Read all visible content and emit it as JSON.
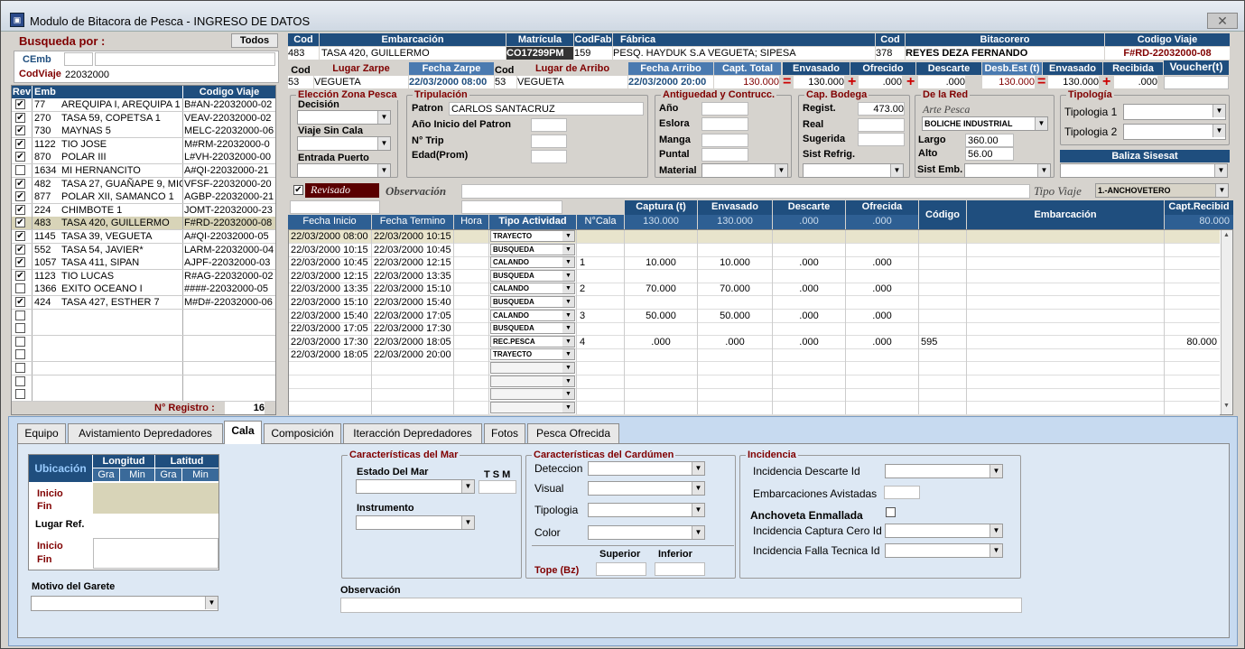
{
  "window": {
    "title": "Modulo de Bitacora de Pesca - INGRESO DE DATOS",
    "close": "✕"
  },
  "search": {
    "label": "Busqueda por :",
    "todos": "Todos",
    "cemb_label": "CEmb",
    "codviaje_label": "CodViaje",
    "cemb_value": "",
    "codviaje_value": "22032000"
  },
  "list": {
    "h_rev": "Rev",
    "h_emb": "Emb",
    "h_cod": "Codigo Viaje",
    "registro_label": "N° Registro :",
    "registro_value": "16",
    "rows": [
      {
        "chk": "✔",
        "num": "77",
        "name": "AREQUIPA I, AREQUIPA 1",
        "code": "B#AN-22032000-02"
      },
      {
        "chk": "✔",
        "num": "270",
        "name": "TASA 59, COPETSA 1",
        "code": "VEAV-22032000-02"
      },
      {
        "chk": "✔",
        "num": "730",
        "name": "MAYNAS 5",
        "code": "MELC-22032000-06"
      },
      {
        "chk": "✔",
        "num": "1122",
        "name": "TIO JOSE",
        "code": "M#RM-22032000-0"
      },
      {
        "chk": "✔",
        "num": "870",
        "name": "POLAR III",
        "code": "L#VH-22032000-00"
      },
      {
        "chk": "",
        "num": "1634",
        "name": "MI HERNANCITO",
        "code": "A#QI-22032000-21"
      },
      {
        "chk": "✔",
        "num": "482",
        "name": "TASA 27, GUAÑAPE 9, MIG",
        "code": "VFSF-22032000-20"
      },
      {
        "chk": "✔",
        "num": "877",
        "name": "POLAR XII, SAMANCO 1",
        "code": "AGBP-22032000-21"
      },
      {
        "chk": "✔",
        "num": "224",
        "name": "CHIMBOTE 1",
        "code": "JOMT-22032000-23"
      },
      {
        "chk": "✔",
        "num": "483",
        "name": "TASA 420, GUILLERMO",
        "code": "F#RD-22032000-08"
      },
      {
        "chk": "✔",
        "num": "1145",
        "name": "TASA 39, VEGUETA",
        "code": "A#QI-22032000-05"
      },
      {
        "chk": "✔",
        "num": "552",
        "name": "TASA 54, JAVIER*",
        "code": "LARM-22032000-04"
      },
      {
        "chk": "✔",
        "num": "1057",
        "name": "TASA 411, SIPAN",
        "code": "AJPF-22032000-03"
      },
      {
        "chk": "✔",
        "num": "1123",
        "name": "TIO LUCAS",
        "code": "R#AG-22032000-02"
      },
      {
        "chk": "",
        "num": "1366",
        "name": "EXITO OCEANO I",
        "code": "####-22032000-05"
      },
      {
        "chk": "✔",
        "num": "424",
        "name": "TASA 427, ESTHER 7",
        "code": "M#D#-22032000-06"
      }
    ]
  },
  "header": {
    "h_cod": "Cod",
    "h_emb": "Embarcación",
    "h_mat": "Matrícula",
    "h_codfab": "CodFab",
    "h_fab": "Fábrica",
    "h_cod2": "Cod",
    "h_bit": "Bitacorero",
    "h_cv": "Codigo Viaje",
    "cod": "483",
    "emb": "TASA 420, GUILLERMO",
    "mat": "CO17299PM",
    "codfab": "159",
    "fab": "PESQ. HAYDUK S.A VEGUETA; SIPESA",
    "cod2": "378",
    "bit": "REYES DEZA FERNANDO",
    "cv": "F#RD-22032000-08"
  },
  "trip": {
    "h_cod": "Cod",
    "h_lz": "Lugar Zarpe",
    "h_fz": "Fecha Zarpe",
    "h_cod2": "Cod",
    "h_la": "Lugar de Arribo",
    "h_fa": "Fecha Arribo",
    "h_ct": "Capt. Total",
    "h_env": "Envasado",
    "h_of": "Ofrecido",
    "h_desc": "Descarte",
    "h_desb": "Desb.Est (t)",
    "h_env2": "Envasado",
    "h_rec": "Recibida",
    "h_vou": "Voucher(t)",
    "cod": "53",
    "lz": "VEGUETA",
    "fz": "22/03/2000 08:00",
    "cod2": "53",
    "la": "VEGUETA",
    "fa": "22/03/2000 20:00",
    "ct": "130.000",
    "env": "130.000",
    "of": ".000",
    "desc": ".000",
    "desb": "130.000",
    "env2": "130.000",
    "rec": ".000",
    "eq": "=",
    "plus": "+"
  },
  "zona": {
    "title": "Elección Zona Pesca",
    "decision": "Decisión",
    "viaje": "Viaje Sin Cala",
    "entrada": "Entrada Puerto"
  },
  "trip2": {
    "title": "Tripulación",
    "patron_l": "Patron",
    "patron": "CARLOS SANTACRUZ",
    "anio_l": "Año Inicio del Patron",
    "trip_l": "N° Trip",
    "edad_l": "Edad(Prom)"
  },
  "antig": {
    "title": "Antiguedad y Contrucc.",
    "anio": "Año",
    "eslora": "Eslora",
    "manga": "Manga",
    "puntal": "Puntal",
    "material": "Material"
  },
  "bodega": {
    "title": "Cap. Bodega",
    "regist": "Regist.",
    "regist_v": "473.00",
    "real": "Real",
    "sugerida": "Sugerida",
    "refrig": "Sist Refrig."
  },
  "red": {
    "title": "De la Red",
    "arte": "Arte Pesca",
    "arte_v": "BOLICHE INDUSTRIAL",
    "largo": "Largo",
    "largo_v": "360.00",
    "alto": "Alto",
    "alto_v": "56.00",
    "sist": "Sist Emb."
  },
  "tipologia": {
    "title": "Tipología",
    "t1": "Tipologia 1",
    "t2": "Tipologia 2",
    "baliza": "Baliza Sisesat"
  },
  "obs": {
    "revisado": "Revisado",
    "obs_l": "Observación",
    "tipo_l": "Tipo Viaje",
    "tipo_v": "1.-ANCHOVETERO"
  },
  "grid": {
    "h_fi": "Fecha Inicio",
    "h_ft": "Fecha Termino",
    "h_hora": "Hora",
    "h_ta": "Tipo Actividad",
    "h_ncala": "N°Cala",
    "h_cap": "Captura (t)",
    "h_env": "Envasado",
    "h_desc": "Descarte",
    "h_of": "Ofrecida",
    "h_cod": "Código",
    "h_emb": "Embarcación",
    "h_capt": "Capt.Recibid",
    "t_cap": "130.000",
    "t_env": "130.000",
    "t_desc": ".000",
    "t_of": ".000",
    "t_capt": "80.000",
    "rows": [
      {
        "fi": "22/03/2000 08:00",
        "ft": "22/03/2000 10:15",
        "ta": "TRAYECTO",
        "n": "",
        "cap": "",
        "env": "",
        "desc": "",
        "of": "",
        "cod": "",
        "capt": ""
      },
      {
        "fi": "22/03/2000 10:15",
        "ft": "22/03/2000 10:45",
        "ta": "BUSQUEDA",
        "n": "",
        "cap": "",
        "env": "",
        "desc": "",
        "of": "",
        "cod": "",
        "capt": ""
      },
      {
        "fi": "22/03/2000 10:45",
        "ft": "22/03/2000 12:15",
        "ta": "CALANDO",
        "n": "1",
        "cap": "10.000",
        "env": "10.000",
        "desc": ".000",
        "of": ".000",
        "cod": "",
        "capt": ""
      },
      {
        "fi": "22/03/2000 12:15",
        "ft": "22/03/2000 13:35",
        "ta": "BUSQUEDA",
        "n": "",
        "cap": "",
        "env": "",
        "desc": "",
        "of": "",
        "cod": "",
        "capt": ""
      },
      {
        "fi": "22/03/2000 13:35",
        "ft": "22/03/2000 15:10",
        "ta": "CALANDO",
        "n": "2",
        "cap": "70.000",
        "env": "70.000",
        "desc": ".000",
        "of": ".000",
        "cod": "",
        "capt": ""
      },
      {
        "fi": "22/03/2000 15:10",
        "ft": "22/03/2000 15:40",
        "ta": "BUSQUEDA",
        "n": "",
        "cap": "",
        "env": "",
        "desc": "",
        "of": "",
        "cod": "",
        "capt": ""
      },
      {
        "fi": "22/03/2000 15:40",
        "ft": "22/03/2000 17:05",
        "ta": "CALANDO",
        "n": "3",
        "cap": "50.000",
        "env": "50.000",
        "desc": ".000",
        "of": ".000",
        "cod": "",
        "capt": ""
      },
      {
        "fi": "22/03/2000 17:05",
        "ft": "22/03/2000 17:30",
        "ta": "BUSQUEDA",
        "n": "",
        "cap": "",
        "env": "",
        "desc": "",
        "of": "",
        "cod": "",
        "capt": ""
      },
      {
        "fi": "22/03/2000 17:30",
        "ft": "22/03/2000 18:05",
        "ta": "REC.PESCA",
        "n": "4",
        "cap": ".000",
        "env": ".000",
        "desc": ".000",
        "of": ".000",
        "cod": "595",
        "capt": "80.000"
      },
      {
        "fi": "22/03/2000 18:05",
        "ft": "22/03/2000 20:00",
        "ta": "TRAYECTO",
        "n": "",
        "cap": "",
        "env": "",
        "desc": "",
        "of": "",
        "cod": "",
        "capt": ""
      },
      {
        "fi": "",
        "ft": "",
        "ta": "",
        "n": "",
        "cap": "",
        "env": "",
        "desc": "",
        "of": "",
        "cod": "",
        "capt": ""
      },
      {
        "fi": "",
        "ft": "",
        "ta": "",
        "n": "",
        "cap": "",
        "env": "",
        "desc": "",
        "of": "",
        "cod": "",
        "capt": ""
      },
      {
        "fi": "",
        "ft": "",
        "ta": "",
        "n": "",
        "cap": "",
        "env": "",
        "desc": "",
        "of": "",
        "cod": "",
        "capt": ""
      },
      {
        "fi": "",
        "ft": "",
        "ta": "",
        "n": "",
        "cap": "",
        "env": "",
        "desc": "",
        "of": "",
        "cod": "",
        "capt": ""
      }
    ]
  },
  "tabs": [
    "Equipo",
    "Avistamiento Depredadores",
    "Cala",
    "Composición",
    "Iteracción Depredadores",
    "Fotos",
    "Pesca Ofrecida"
  ],
  "cala": {
    "ubic": "Ubicación",
    "long": "Longitud",
    "lat": "Latitud",
    "gra": "Gra",
    "min": "Min",
    "inicio": "Inicio",
    "fin": "Fin",
    "lugar": "Lugar Ref.",
    "motivo": "Motivo del Garete",
    "mar_t": "Características del Mar",
    "estado": "Estado Del Mar",
    "tsm": "T S M",
    "instr": "Instrumento",
    "card_t": "Características del Cardúmen",
    "deteccion": "Deteccion",
    "visual": "Visual",
    "tipologia": "Tipologia",
    "color": "Color",
    "superior": "Superior",
    "inferior": "Inferior",
    "tope": "Tope (Bz)",
    "inc_t": "Incidencia",
    "inc_desc": "Incidencia Descarte Id",
    "emb_av": "Embarcaciones Avistadas",
    "anch": "Anchoveta Enmallada",
    "inc_cap": "Incidencia Captura Cero Id",
    "inc_fall": "Incidencia Falla Tecnica Id",
    "obs": "Observación"
  }
}
